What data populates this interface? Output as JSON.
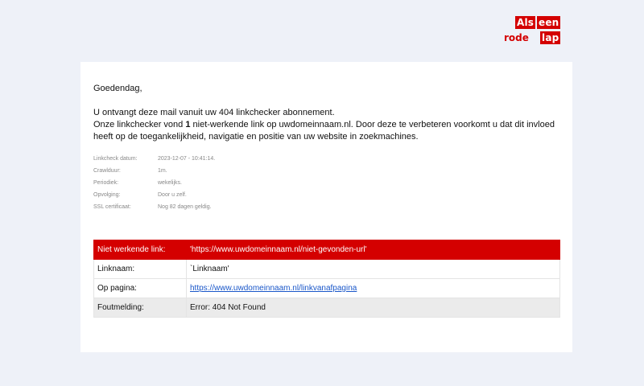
{
  "logo": {
    "word1": "Als",
    "word2": "een",
    "word3": "rode",
    "word4": "lap"
  },
  "email": {
    "greeting": "Goedendag,",
    "line1": "U ontvangt deze mail vanuit uw 404 linkchecker abonnement.",
    "line2_before": "Onze linkchecker vond ",
    "line2_count": "1",
    "line2_after": " niet-werkende link op uwdomeinnaam.nl. Door deze te verbeteren voorkomt u dat dit invloed heeft op de toegankelijkheid, navigatie en positie van uw website in zoekmachines."
  },
  "meta": [
    {
      "label": "Linkcheck datum:",
      "value": "2023-12-07 - 10:41:14."
    },
    {
      "label": "Crawlduur:",
      "value": "1m."
    },
    {
      "label": "Periodiek:",
      "value": "wekelijks."
    },
    {
      "label": "Opvolging:",
      "value": "Door u zelf."
    },
    {
      "label": "SSL certificaat:",
      "value": "Nog 82 dagen geldig."
    }
  ],
  "table": {
    "broken_label": "Niet werkende link:",
    "broken_value": "'https://www.uwdomeinnaam.nl/niet-gevonden-url'",
    "name_label": "Linknaam:",
    "name_value": "`Linknaam'",
    "page_label": "Op pagina:",
    "page_value": "https://www.uwdomeinnaam.nl/linkvanafpagina",
    "error_label": "Foutmelding:",
    "error_value": "Error: 404 Not Found"
  },
  "colors": {
    "brand_red": "#d40000",
    "link_blue": "#1a57c9",
    "background": "#eef1f8"
  }
}
